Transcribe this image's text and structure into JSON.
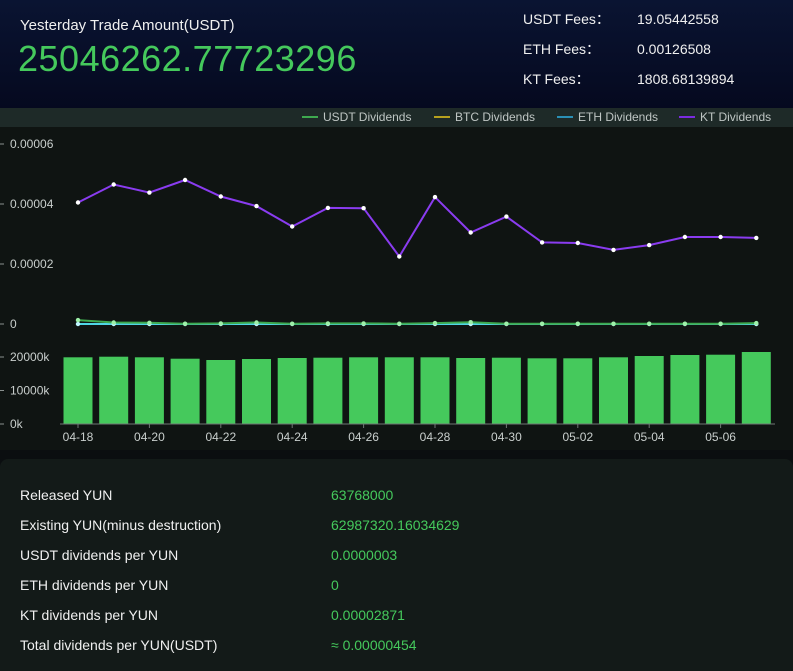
{
  "header": {
    "trade_label": "Yesterday Trade Amount(USDT)",
    "trade_amount": "25046262.77723296",
    "fees": [
      {
        "label": "USDT Fees：",
        "value": "19.05442558"
      },
      {
        "label": "ETH Fees：",
        "value": "0.00126508"
      },
      {
        "label": "KT Fees：",
        "value": "1808.68139894"
      }
    ]
  },
  "colors": {
    "accent_green": "#45c95c",
    "usdt": "#3ea94f",
    "btc": "#b7a11e",
    "eth": "#2a8fb5",
    "kt": "#7b2be0",
    "bar": "#45c95c"
  },
  "chart_data": {
    "type": "line",
    "legend": [
      {
        "name": "USDT Dividends",
        "color": "#3ea94f"
      },
      {
        "name": "BTC Dividends",
        "color": "#b7a11e"
      },
      {
        "name": "ETH Dividends",
        "color": "#2a8fb5"
      },
      {
        "name": "KT Dividends",
        "color": "#7b2be0"
      }
    ],
    "x_tick_labels": [
      "04-18",
      "04-20",
      "04-22",
      "04-24",
      "04-26",
      "04-28",
      "04-30",
      "05-02",
      "05-04",
      "05-06"
    ],
    "x": [
      "04-18",
      "04-19",
      "04-20",
      "04-21",
      "04-22",
      "04-23",
      "04-24",
      "04-25",
      "04-26",
      "04-27",
      "04-28",
      "04-29",
      "04-30",
      "05-01",
      "05-02",
      "05-03",
      "05-04",
      "05-05",
      "05-06",
      "05-07"
    ],
    "upper": {
      "y_ticks": [
        "0.00006",
        "0.00004",
        "0.00002",
        "0"
      ],
      "ylim": [
        0,
        6e-05
      ],
      "series": [
        {
          "name": "KT Dividends",
          "color": "#7b2be0",
          "values": [
            4.05e-05,
            4.65e-05,
            4.38e-05,
            4.8e-05,
            4.25e-05,
            3.93e-05,
            3.25e-05,
            3.87e-05,
            3.86e-05,
            2.25e-05,
            4.23e-05,
            3.05e-05,
            3.58e-05,
            2.72e-05,
            2.7e-05,
            2.47e-05,
            2.63e-05,
            2.9e-05,
            2.9e-05,
            2.87e-05
          ]
        },
        {
          "name": "USDT Dividends",
          "color": "#3ea94f",
          "values": [
            1.3e-06,
            5e-07,
            4e-07,
            1e-07,
            2e-07,
            5e-07,
            1e-07,
            2e-07,
            2e-07,
            1e-07,
            3e-07,
            6e-07,
            1e-07,
            1e-07,
            1e-07,
            1e-07,
            1e-07,
            1e-07,
            1e-07,
            3e-07
          ]
        },
        {
          "name": "ETH Dividends",
          "color": "#2a8fb5",
          "values": [
            0,
            0,
            0,
            0,
            0,
            0,
            0,
            0,
            0,
            0,
            0,
            0,
            0,
            0,
            0,
            0,
            0,
            0,
            0,
            0
          ]
        }
      ]
    },
    "lower": {
      "type": "bar",
      "y_ticks": [
        "20000k",
        "10000k",
        "0k"
      ],
      "ylim": [
        0,
        22000000
      ],
      "values": [
        19900000,
        20100000,
        19900000,
        19500000,
        19100000,
        19400000,
        19700000,
        19800000,
        19900000,
        19900000,
        19900000,
        19700000,
        19800000,
        19600000,
        19600000,
        19900000,
        20300000,
        20600000,
        20700000,
        21500000
      ]
    }
  },
  "info": [
    {
      "label": "Released YUN",
      "value": "63768000"
    },
    {
      "label": "Existing YUN(minus destruction)",
      "value": "62987320.16034629"
    },
    {
      "label": "USDT dividends per YUN",
      "value": "0.0000003"
    },
    {
      "label": "ETH dividends per YUN",
      "value": "0"
    },
    {
      "label": "KT dividends per YUN",
      "value": "0.00002871"
    },
    {
      "label": "Total dividends per YUN(USDT)",
      "value": "≈ 0.00000454"
    }
  ]
}
